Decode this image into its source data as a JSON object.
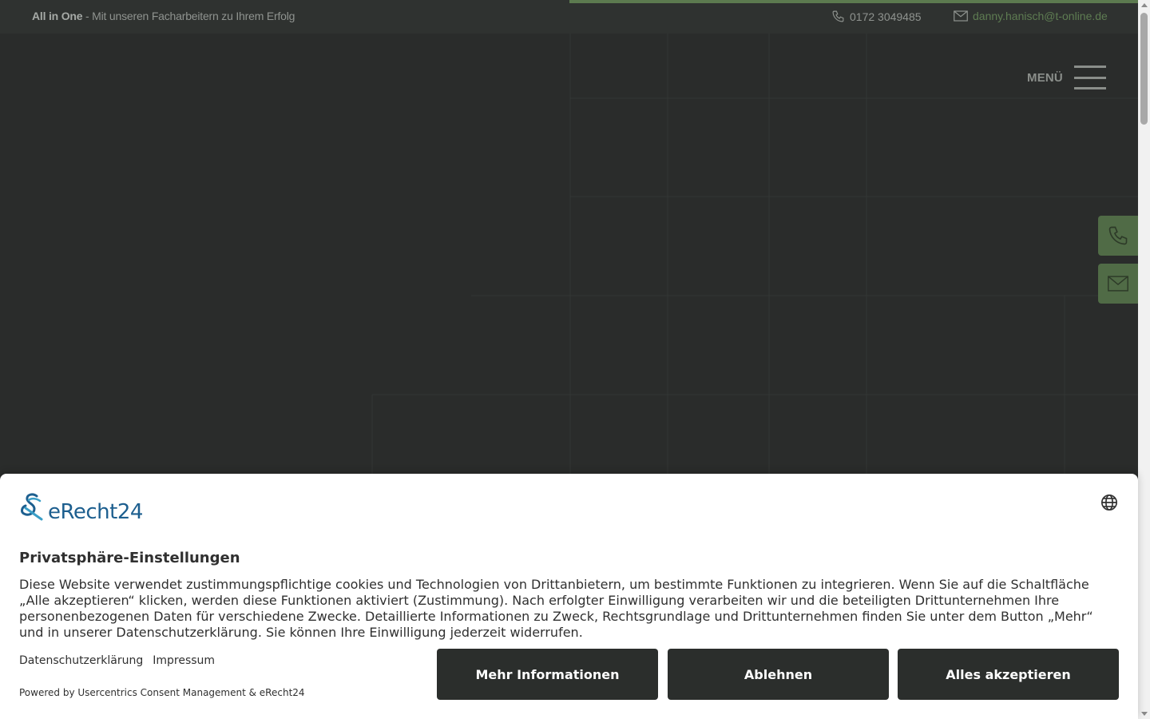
{
  "topbar": {
    "tagline_strong": "All in One",
    "tagline_rest": " - Mit unseren Facharbeitern zu Ihrem Erfolg",
    "phone": "0172 3049485",
    "email": "danny.hanisch@t-online.de"
  },
  "menu": {
    "label": "MENÜ"
  },
  "side_buttons": [
    {
      "icon": "phone-icon"
    },
    {
      "icon": "mail-icon"
    }
  ],
  "consent": {
    "brand": "eRecht24",
    "title": "Privatsphäre-Einstellungen",
    "text": "Diese Website verwendet zustimmungspflichtige cookies und Technologien von Drittanbietern, um bestimmte Funktionen zu integrieren. Wenn Sie auf die Schaltfläche „Alle akzeptieren“ klicken, werden diese Funktionen aktiviert (Zustimmung). Nach erfolgter Einwilligung verarbeiten wir und die beteiligten Drittunternehmen Ihre personenbezogenen Daten für verschiedene Zwecke. Detaillierte Informationen zu Zweck, Rechtsgrundlage und Drittunternehmen finden Sie unter dem Button „Mehr“ und in unserer Datenschutzerklärung. Sie können Ihre Einwilligung jederzeit widerrufen.",
    "link_privacy": "Datenschutzerklärung",
    "link_imprint": "Impressum",
    "powered": "Powered by Usercentrics Consent Management & eRecht24",
    "btn_more": "Mehr Informationen",
    "btn_decline": "Ablehnen",
    "btn_accept": "Alles akzeptieren"
  },
  "colors": {
    "accent_green": "#5c7a4f",
    "side_button_green": "#506b46",
    "dark_button": "#2b2e2c",
    "brand_blue": "#1d5f8f"
  }
}
